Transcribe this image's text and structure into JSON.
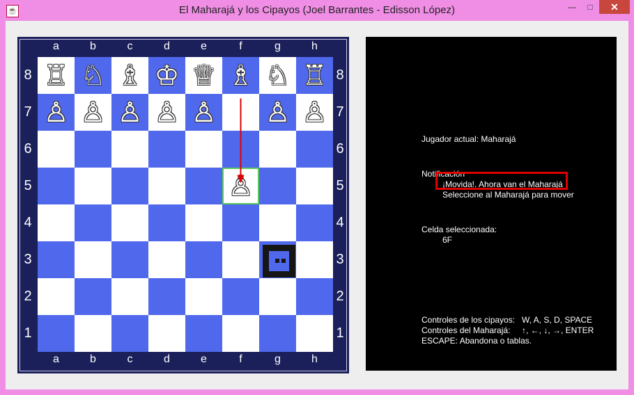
{
  "window": {
    "title": "El Maharajá y los Cipayos (Joel Barrantes - Edisson López)",
    "minimize": "—",
    "maximize": "□",
    "close": "✕"
  },
  "board": {
    "files": [
      "a",
      "b",
      "c",
      "d",
      "e",
      "f",
      "g",
      "h"
    ],
    "ranks": [
      "8",
      "7",
      "6",
      "5",
      "4",
      "3",
      "2",
      "1"
    ],
    "light_color": "#ffffff",
    "dark_color": "#5068ec",
    "pieces": {
      "a8": "♖",
      "b8": "♘",
      "c8": "♗",
      "d8": "♔",
      "e8": "♕",
      "f8": "♗",
      "g8": "♘",
      "h8": "♖",
      "a7": "♙",
      "b7": "♙",
      "c7": "♙",
      "d7": "♙",
      "e7": "♙",
      "g7": "♙",
      "h7": "♙",
      "f5": "♙"
    },
    "maharaja_square": "g3",
    "selected_square": "f5",
    "last_move": {
      "from": "f7",
      "to": "f5",
      "arrow_color": "#e00000"
    }
  },
  "panel": {
    "current_player": "Jugador actual: Maharajá",
    "notification_title": "Notificación",
    "notification_line1": "¡Movida!. Ahora van el Maharajá",
    "notification_line2": "Seleccione al Maharajá para mover",
    "selected_cell_title": "Celda seleccionada:",
    "selected_cell_value": "6F",
    "controls_cipayos_label": "Controles de los cipayos:",
    "controls_cipayos_keys": "W, A, S, D, SPACE",
    "controls_maharaja_label": "Controles del Maharajá:",
    "controls_maharaja_keys": "↑, ←, ↓, →, ENTER",
    "escape_text": "ESCAPE: Abandona o tablas."
  }
}
